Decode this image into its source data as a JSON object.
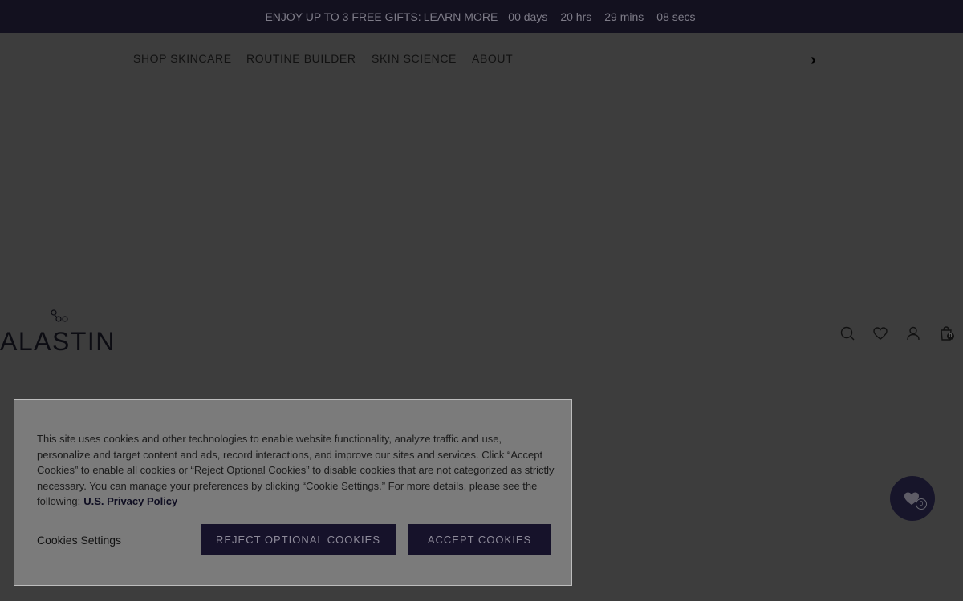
{
  "promo": {
    "text": "ENJOY UP TO 3 FREE GIFTS:",
    "link": "LEARN MORE",
    "countdown": {
      "days": "00",
      "days_unit": "days",
      "hrs": "20",
      "hrs_unit": "hrs",
      "mins": "29",
      "mins_unit": "mins",
      "secs": "08",
      "secs_unit": "secs"
    }
  },
  "nav": {
    "items": [
      "SHOP SKINCARE",
      "ROUTINE BUILDER",
      "SKIN SCIENCE",
      "ABOUT"
    ],
    "next_arrow": "›"
  },
  "logo": {
    "text": "ALASTIN"
  },
  "header_icons": [
    "search-icon",
    "heart-icon",
    "account-icon",
    "cart-icon"
  ],
  "cart": {
    "count": "0"
  },
  "cookie": {
    "text": "This site uses cookies and other technologies to enable website functionality, analyze traffic and use, personalize and target content and ads, record interactions, and improve our sites and services. Click “Accept Cookies” to enable all cookies or “Reject Optional Cookies” to disable cookies that are not categorized as strictly necessary. You can manage your preferences by clicking “Cookie Settings.” For more details, please see the following:",
    "privacy_link": "U.S. Privacy Policy",
    "settings_label": "Cookies Settings",
    "reject_label": "REJECT OPTIONAL COOKIES",
    "accept_label": "ACCEPT COOKIES"
  },
  "wishlist": {
    "count": "0"
  },
  "colors": {
    "promo_bg": "#13111f",
    "overlay_bg": "#3d3d3d",
    "button_bg": "#16122a",
    "banner_bg": "#7b7b7b"
  }
}
